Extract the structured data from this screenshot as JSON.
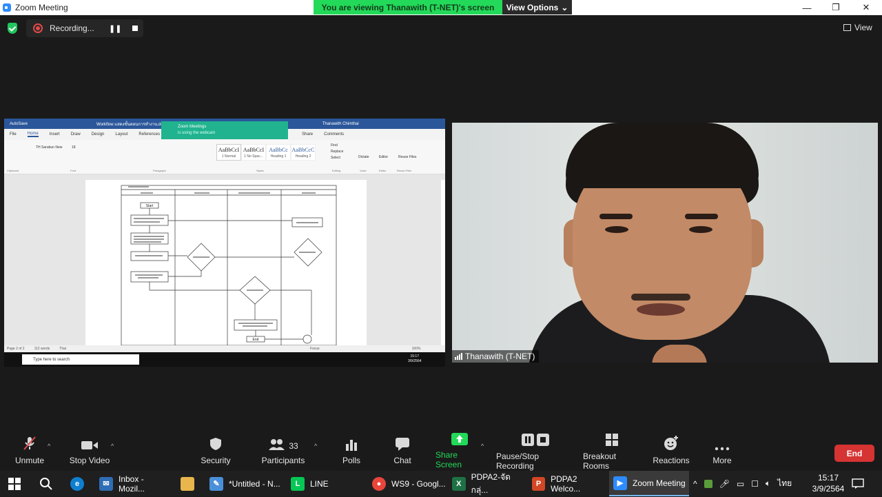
{
  "window": {
    "title": "Zoom Meeting",
    "minimize": "—",
    "restore": "❐",
    "close": "✕"
  },
  "banner": {
    "viewing": "You are viewing Thanawith (T-NET)'s screen",
    "view_options": "View Options",
    "chevron": "⌄"
  },
  "recording": {
    "label": "Recording...",
    "pause": "❚❚"
  },
  "view": {
    "label": "View"
  },
  "shared_screen": {
    "doc_title": "Workflow แสดงขั้นตอนการทำงาน.docx",
    "user": "Thanawith Chimthai",
    "autosave": "AutoSave",
    "menu": [
      "File",
      "Home",
      "Insert",
      "Draw",
      "Design",
      "Layout",
      "References"
    ],
    "share": "Share",
    "comments": "Comments",
    "font": "TH Sarabun New",
    "font_size": "18",
    "styles": [
      {
        "sample": "AaBbCcI",
        "name": "1 Normal"
      },
      {
        "sample": "AaBbCcI",
        "name": "1 No Spac..."
      },
      {
        "sample": "AaBbCc",
        "name": "Heading 1"
      },
      {
        "sample": "AaBbCcC",
        "name": "Heading 2"
      }
    ],
    "editing": [
      "Find",
      "Replace",
      "Select"
    ],
    "ribbon_groups": [
      "Clipboard",
      "Font",
      "Paragraph",
      "Styles",
      "Editing",
      "Voice",
      "Editor",
      "Reuse Files"
    ],
    "ribbon_tools": [
      "Dictate",
      "Editor",
      "Reuse Files"
    ],
    "toast_title": "Zoom Meetings",
    "toast_sub": "is using the webcam",
    "status": [
      "Page 2 of 2",
      "112 words",
      "Thai"
    ],
    "focus": "Focus",
    "zoom": "100%",
    "search": "Type here to search",
    "time": "15:17",
    "date": "3/9/2564",
    "flow": {
      "start": "Start",
      "end": "End"
    }
  },
  "video": {
    "name": "Thanawith (T-NET)"
  },
  "toolbar": {
    "unmute": "Unmute",
    "stop_video": "Stop Video",
    "security": "Security",
    "participants": "Participants",
    "participants_count": "33",
    "polls": "Polls",
    "chat": "Chat",
    "share_screen": "Share Screen",
    "pause_recording": "Pause/Stop Recording",
    "breakout": "Breakout Rooms",
    "reactions": "Reactions",
    "more": "More",
    "end": "End",
    "caret": "^"
  },
  "taskbar": {
    "apps": [
      {
        "label": "Inbox - Mozil...",
        "color": "#2f6db5"
      },
      {
        "label": "*Untitled - N...",
        "color": "#4a90d9"
      },
      {
        "label": "LINE",
        "color": "#06c755"
      },
      {
        "label": "WS9 - Googl...",
        "color": "#e8453c"
      },
      {
        "label": "PDPA2-จัดกลุ่...",
        "color": "#1e7145"
      },
      {
        "label": "PDPA2 Welco...",
        "color": "#d24726"
      },
      {
        "label": "Zoom Meeting",
        "color": "#2d8cff"
      }
    ],
    "lang": "ไทย",
    "time": "15:17",
    "date": "3/9/2564"
  }
}
